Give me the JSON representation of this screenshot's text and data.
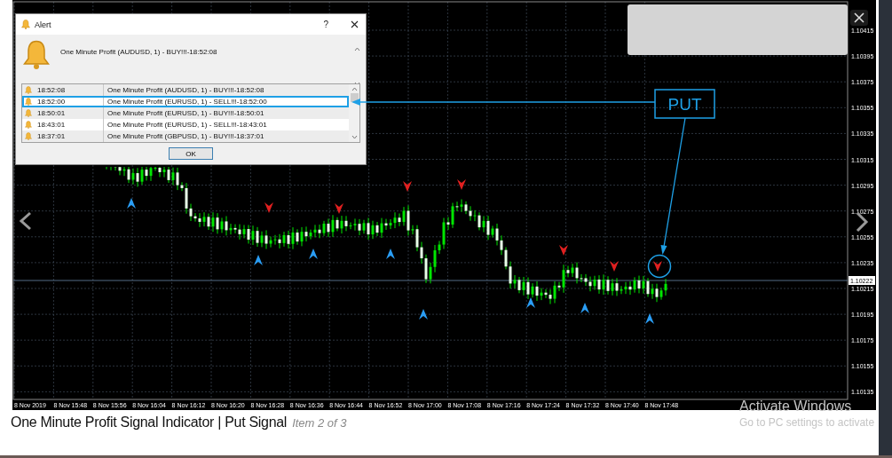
{
  "dialog": {
    "title": "Alert",
    "help": "?",
    "message": "One Minute Profit (AUDUSD, 1) - BUY!!!-18:52:08",
    "ok": "OK",
    "rows": [
      {
        "time": "18:52:08",
        "text": "One Minute Profit (AUDUSD, 1) - BUY!!!-18:52:08",
        "selected": false
      },
      {
        "time": "18:52:00",
        "text": "One Minute Profit (EURUSD, 1) - SELL!!!-18:52:00",
        "selected": true
      },
      {
        "time": "18:50:01",
        "text": "One Minute Profit (EURUSD, 1) - BUY!!!-18:50:01",
        "selected": false
      },
      {
        "time": "18:43:01",
        "text": "One Minute Profit (EURUSD, 1) - SELL!!!-18:43:01",
        "selected": false
      },
      {
        "time": "18:37:01",
        "text": "One Minute Profit (GBPUSD, 1) - BUY!!!-18:37:01",
        "selected": false
      }
    ]
  },
  "chart": {
    "price_labels": [
      "1.10415",
      "1.10395",
      "1.10375",
      "1.10355",
      "1.10335",
      "1.10315",
      "1.10295",
      "1.10275",
      "1.10255",
      "1.10235",
      "1.10215",
      "1.10195",
      "1.10175",
      "1.10155",
      "1.10135"
    ],
    "current_price": "1.10222",
    "time_labels": [
      "8 Nov 2019",
      "8 Nov 15:48",
      "8 Nov 15:56",
      "8 Nov 16:04",
      "8 Nov 16:12",
      "8 Nov 16:20",
      "8 Nov 16:28",
      "8 Nov 16:36",
      "8 Nov 16:44",
      "8 Nov 16:52",
      "8 Nov 17:00",
      "8 Nov 17:08",
      "8 Nov 17:16",
      "8 Nov 17:24",
      "8 Nov 17:32",
      "8 Nov 17:40",
      "8 Nov 17:48"
    ],
    "callout": "PUT"
  },
  "caption": {
    "title": "One Minute Profit Signal Indicator | Put Signal",
    "counter": "Item 2 of 3"
  },
  "os_notice": {
    "title": "Activate Windows",
    "subtitle": "Go to PC settings to activate"
  }
}
